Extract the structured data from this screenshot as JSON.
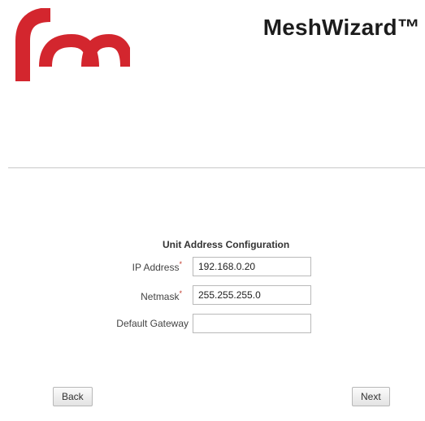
{
  "app": {
    "title": "MeshWizard™",
    "brand_color": "#d3262e"
  },
  "form": {
    "title": "Unit Address Configuration",
    "fields": [
      {
        "label": "IP Address",
        "required": true,
        "value": "192.168.0.20"
      },
      {
        "label": "Netmask",
        "required": true,
        "value": "255.255.255.0"
      },
      {
        "label": "Default Gateway",
        "required": false,
        "value": ""
      }
    ],
    "required_marker": "*"
  },
  "nav": {
    "back_label": "Back",
    "next_label": "Next"
  }
}
